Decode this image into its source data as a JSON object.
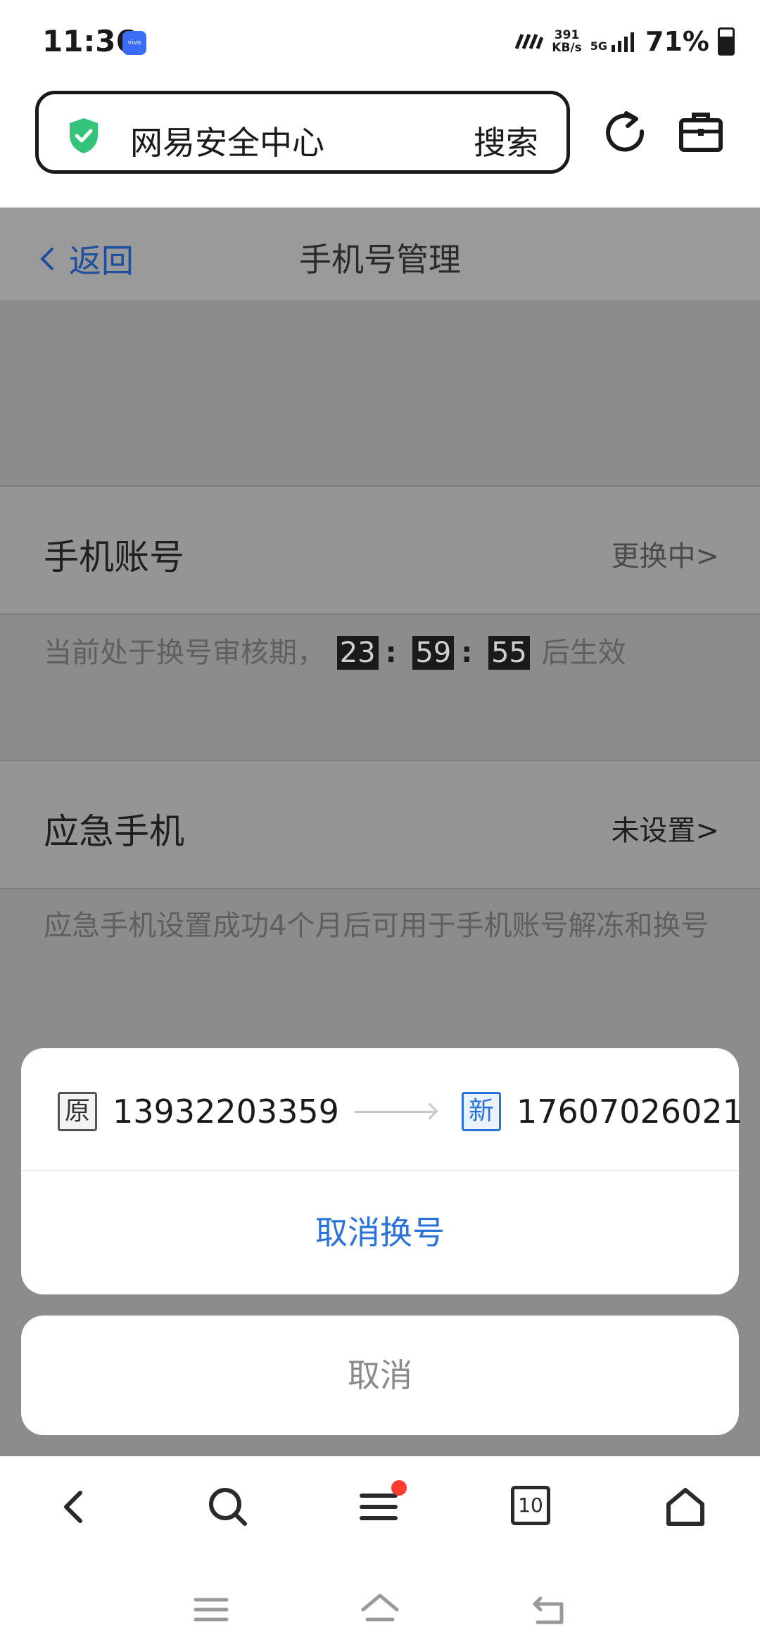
{
  "status_bar": {
    "time": "11:36",
    "brand_badge": "vivo",
    "net_speed_value": "391",
    "net_speed_unit": "KB/s",
    "network": "5G",
    "battery": "71%"
  },
  "browser": {
    "site_title": "网易安全中心",
    "search_label": "搜索",
    "icons": [
      "shield-check-icon",
      "refresh-icon",
      "toolbox-icon"
    ]
  },
  "header": {
    "back_label": "返回",
    "title": "手机号管理"
  },
  "phone_account": {
    "label": "手机账号",
    "status": "更换中>",
    "note_prefix": "当前处于换号审核期，",
    "countdown": [
      "23",
      "59",
      "55"
    ],
    "note_suffix": "后生效"
  },
  "emergency_phone": {
    "label": "应急手机",
    "status": "未设置>",
    "note": "应急手机设置成功4个月后可用于手机账号解冻和换号"
  },
  "sheet": {
    "old_tag": "原",
    "old_number": "13932203359",
    "new_tag": "新",
    "new_number": "17607026021",
    "action_label": "取消换号",
    "cancel_label": "取消"
  },
  "bottom_nav": {
    "tabs_count": "10",
    "icons": [
      "back-icon",
      "search-icon",
      "menu-icon",
      "tabs-icon",
      "home-icon"
    ]
  },
  "colors": {
    "accent_blue": "#2a72d8",
    "link_blue": "#1d4f9e",
    "shield_green": "#35c27a",
    "notification_red": "#ff3b30"
  }
}
